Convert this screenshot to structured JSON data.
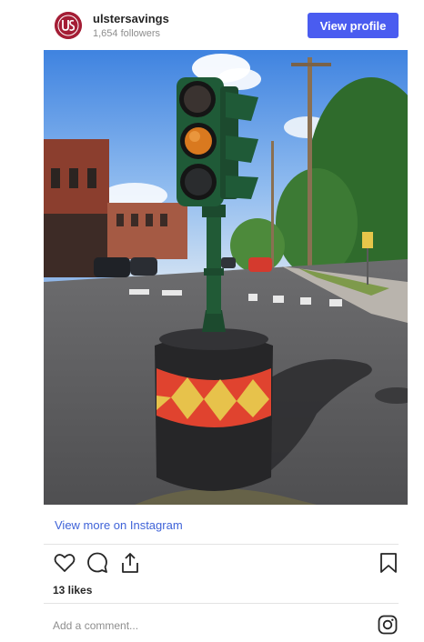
{
  "header": {
    "username": "ulstersavings",
    "followers": "1,654 followers",
    "view_profile_label": "View profile"
  },
  "post": {
    "image_alt": "Traffic signal on a painted pedestal in a street",
    "view_more_label": "View more on Instagram",
    "likes": "13 likes",
    "comment_placeholder": "Add a comment..."
  },
  "icons": {
    "like": "heart-icon",
    "comment": "comment-icon",
    "share": "share-icon",
    "save": "bookmark-icon",
    "brand": "instagram-icon"
  },
  "colors": {
    "button": "#4a5cf0",
    "link": "#3f63d8",
    "avatar": "#a41d35"
  }
}
